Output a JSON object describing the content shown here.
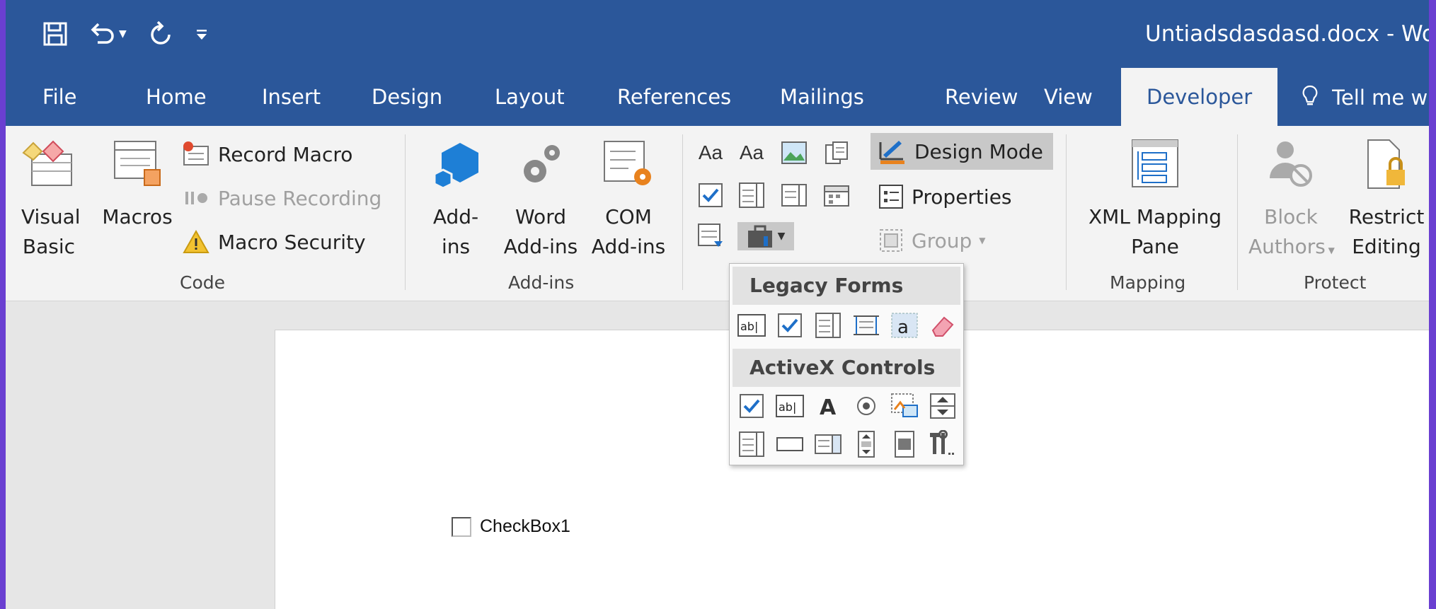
{
  "window": {
    "title": "Untiadsdasdasd.docx  -  Wor"
  },
  "qat": {
    "save_icon": "save-icon",
    "undo_icon": "undo-icon",
    "redo_icon": "redo-icon",
    "customize_icon": "customize-qat-icon"
  },
  "tabs": [
    {
      "label": "File"
    },
    {
      "label": "Home"
    },
    {
      "label": "Insert"
    },
    {
      "label": "Design"
    },
    {
      "label": "Layout"
    },
    {
      "label": "References"
    },
    {
      "label": "Mailings"
    },
    {
      "label": "Review"
    },
    {
      "label": "View"
    },
    {
      "label": "Developer"
    }
  ],
  "tell_me": {
    "label": "Tell me w"
  },
  "ribbon": {
    "code": {
      "label": "Code",
      "visual_basic_1": "Visual",
      "visual_basic_2": "Basic",
      "macros": "Macros",
      "record_macro": "Record Macro",
      "pause_recording": "Pause Recording",
      "macro_security": "Macro Security"
    },
    "addins": {
      "label": "Add-ins",
      "addins_1": "Add-",
      "addins_2": "ins",
      "word_addins_1": "Word",
      "word_addins_2": "Add-ins",
      "com_addins_1": "COM",
      "com_addins_2": "Add-ins"
    },
    "controls": {
      "aa1": "Aa",
      "aa2": "Aa",
      "design_mode": "Design Mode",
      "properties": "Properties",
      "group": "Group"
    },
    "mapping": {
      "label": "Mapping",
      "xml_1": "XML Mapping",
      "xml_2": "Pane"
    },
    "protect": {
      "label": "Protect",
      "block_1": "Block",
      "block_2": "Authors",
      "restrict_1": "Restrict",
      "restrict_2": "Editing"
    }
  },
  "dropdown": {
    "legacy_forms": "Legacy Forms",
    "activex_controls": "ActiveX Controls"
  },
  "document": {
    "checkbox_label": "CheckBox1"
  },
  "colors": {
    "accent": "#2b579a",
    "ribbon_bg": "#f3f3f3",
    "frame": "#6a3fd1"
  }
}
